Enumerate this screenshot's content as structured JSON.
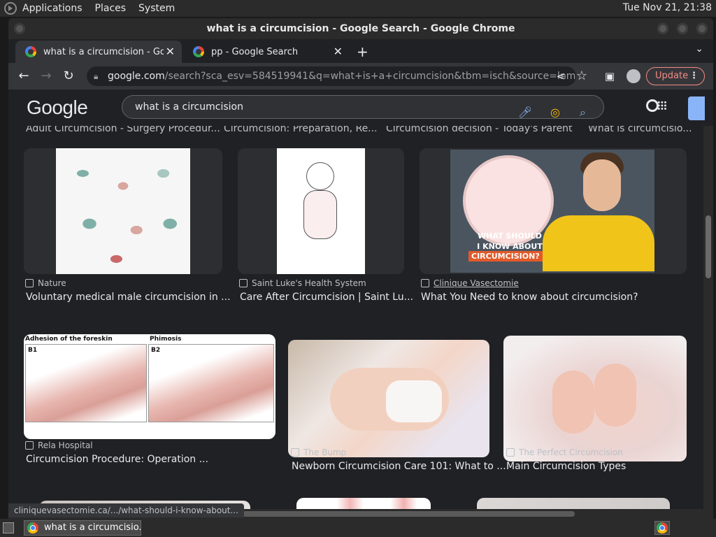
{
  "os_panel": {
    "menus": [
      "Applications",
      "Places",
      "System"
    ],
    "clock": "Tue Nov 21, 21:38"
  },
  "window": {
    "title": "what is a circumcision - Google Search - Google Chrome"
  },
  "tabs": [
    {
      "title": "what is a circumcision - Googl",
      "active": true
    },
    {
      "title": "pp - Google Search",
      "active": false
    }
  ],
  "toolbar": {
    "url_host": "google.com",
    "url_path": "/search?sca_esv=584519941&q=what+is+a+circumcision&tbm=isch&source=lnms&sa=...",
    "update_label": "Update"
  },
  "google": {
    "logo": "Google",
    "query": "what is a circumcision"
  },
  "top_captions": [
    "Adult Circumcision - Surgery Procedur...",
    "Circumcision: Preparation, Re...",
    "Circumcision decision - Today's Parent",
    "What is circumcisio..."
  ],
  "results": [
    {
      "source": "Nature",
      "title": "Voluntary medical male circumcision in ..."
    },
    {
      "source": "Saint Luke's Health System",
      "title": "Care After Circumcision | Saint Lu..."
    },
    {
      "source": "Clinique Vasectomie",
      "title": "What You Need to know about circumcision?",
      "image_text": [
        "WHAT SHOULD",
        "I KNOW ABOUT",
        "CIRCUMCISION?"
      ]
    },
    {
      "source": "Rela Hospital",
      "title": "Circumcision Procedure: Operation ...",
      "image_labels": [
        "Adhesion of the foreskin",
        "Phimosis",
        "B1",
        "B2"
      ]
    },
    {
      "source": "The Bump",
      "title": "Newborn Circumcision Care 101: What to ..."
    },
    {
      "source": "The Perfect Circumcision",
      "title": "Main Circumcision Types"
    }
  ],
  "status_url": "cliniquevasectomie.ca/.../what-should-i-know-about...",
  "taskbar": {
    "window_label": "what is a circumcisio..."
  }
}
